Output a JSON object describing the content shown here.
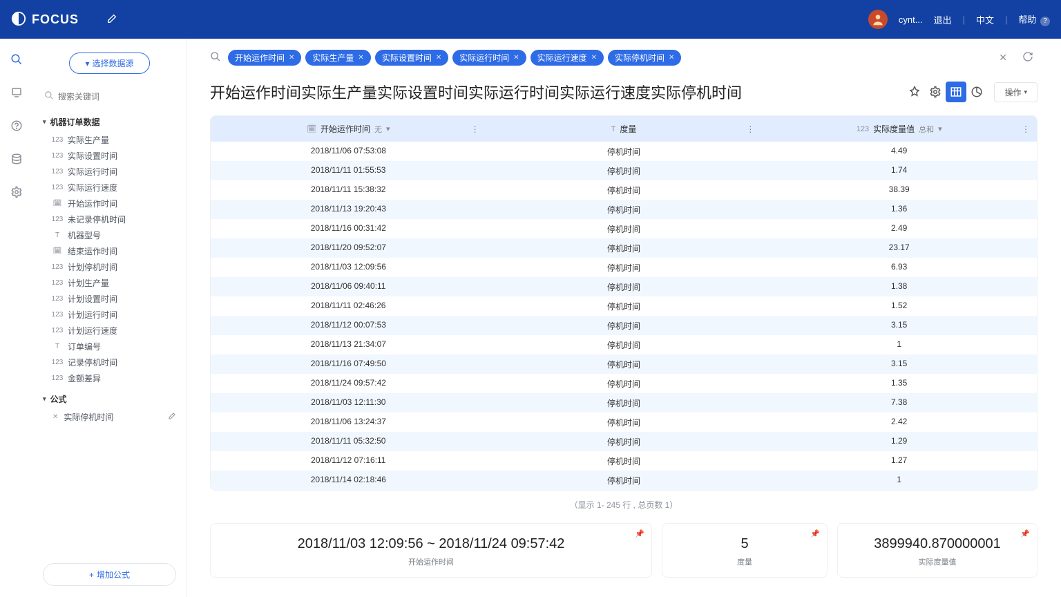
{
  "header": {
    "brand": "FOCUS",
    "user": "cynt...",
    "logout": "退出",
    "lang": "中文",
    "help": "帮助"
  },
  "sidebar": {
    "select_ds": "选择数据源",
    "search_placeholder": "搜索关键词",
    "source_section": "机器订单数据",
    "fields": [
      {
        "icon": "123",
        "label": "实际生产量"
      },
      {
        "icon": "123",
        "label": "实际设置时间"
      },
      {
        "icon": "123",
        "label": "实际运行时间"
      },
      {
        "icon": "123",
        "label": "实际运行速度"
      },
      {
        "icon": "cal",
        "label": "开始运作时间"
      },
      {
        "icon": "123",
        "label": "未记录停机时间"
      },
      {
        "icon": "T",
        "label": "机器型号"
      },
      {
        "icon": "cal",
        "label": "结束运作时间"
      },
      {
        "icon": "123",
        "label": "计划停机时间"
      },
      {
        "icon": "123",
        "label": "计划生产量"
      },
      {
        "icon": "123",
        "label": "计划设置时间"
      },
      {
        "icon": "123",
        "label": "计划运行时间"
      },
      {
        "icon": "123",
        "label": "计划运行速度"
      },
      {
        "icon": "T",
        "label": "订单编号"
      },
      {
        "icon": "123",
        "label": "记录停机时间"
      },
      {
        "icon": "123",
        "label": "金额差异"
      }
    ],
    "formula_section": "公式",
    "formula_item": "实际停机时间",
    "add_formula": "增加公式"
  },
  "query": {
    "pills": [
      "开始运作时间",
      "实际生产量",
      "实际设置时间",
      "实际运行时间",
      "实际运行速度",
      "实际停机时间"
    ]
  },
  "title": "开始运作时间实际生产量实际设置时间实际运行时间实际运行速度实际停机时间",
  "ops": "操作",
  "table": {
    "col1": "开始运作时间",
    "col1_sub": "无",
    "col2": "度量",
    "col3": "实际度量值",
    "col3_sub": "总和",
    "rows": [
      {
        "c1": "2018/11/06 07:53:08",
        "c2": "停机时间",
        "c3": "4.49"
      },
      {
        "c1": "2018/11/11 01:55:53",
        "c2": "停机时间",
        "c3": "1.74"
      },
      {
        "c1": "2018/11/11 15:38:32",
        "c2": "停机时间",
        "c3": "38.39"
      },
      {
        "c1": "2018/11/13 19:20:43",
        "c2": "停机时间",
        "c3": "1.36"
      },
      {
        "c1": "2018/11/16 00:31:42",
        "c2": "停机时间",
        "c3": "2.49"
      },
      {
        "c1": "2018/11/20 09:52:07",
        "c2": "停机时间",
        "c3": "23.17"
      },
      {
        "c1": "2018/11/03 12:09:56",
        "c2": "停机时间",
        "c3": "6.93"
      },
      {
        "c1": "2018/11/06 09:40:11",
        "c2": "停机时间",
        "c3": "1.38"
      },
      {
        "c1": "2018/11/11 02:46:26",
        "c2": "停机时间",
        "c3": "1.52"
      },
      {
        "c1": "2018/11/12 00:07:53",
        "c2": "停机时间",
        "c3": "3.15"
      },
      {
        "c1": "2018/11/13 21:34:07",
        "c2": "停机时间",
        "c3": "1"
      },
      {
        "c1": "2018/11/16 07:49:50",
        "c2": "停机时间",
        "c3": "3.15"
      },
      {
        "c1": "2018/11/24 09:57:42",
        "c2": "停机时间",
        "c3": "1.35"
      },
      {
        "c1": "2018/11/03 12:11:30",
        "c2": "停机时间",
        "c3": "7.38"
      },
      {
        "c1": "2018/11/06 13:24:37",
        "c2": "停机时间",
        "c3": "2.42"
      },
      {
        "c1": "2018/11/11 05:32:50",
        "c2": "停机时间",
        "c3": "1.29"
      },
      {
        "c1": "2018/11/12 07:16:11",
        "c2": "停机时间",
        "c3": "1.27"
      },
      {
        "c1": "2018/11/14 02:18:46",
        "c2": "停机时间",
        "c3": "1"
      }
    ],
    "footer": "（显示 1- 245 行 , 总页数 1）"
  },
  "cards": {
    "c1_val": "2018/11/03 12:09:56 ~ 2018/11/24 09:57:42",
    "c1_lbl": "开始运作时间",
    "c2_val": "5",
    "c2_lbl": "度量",
    "c3_val": "3899940.870000001",
    "c3_lbl": "实际度量值"
  }
}
